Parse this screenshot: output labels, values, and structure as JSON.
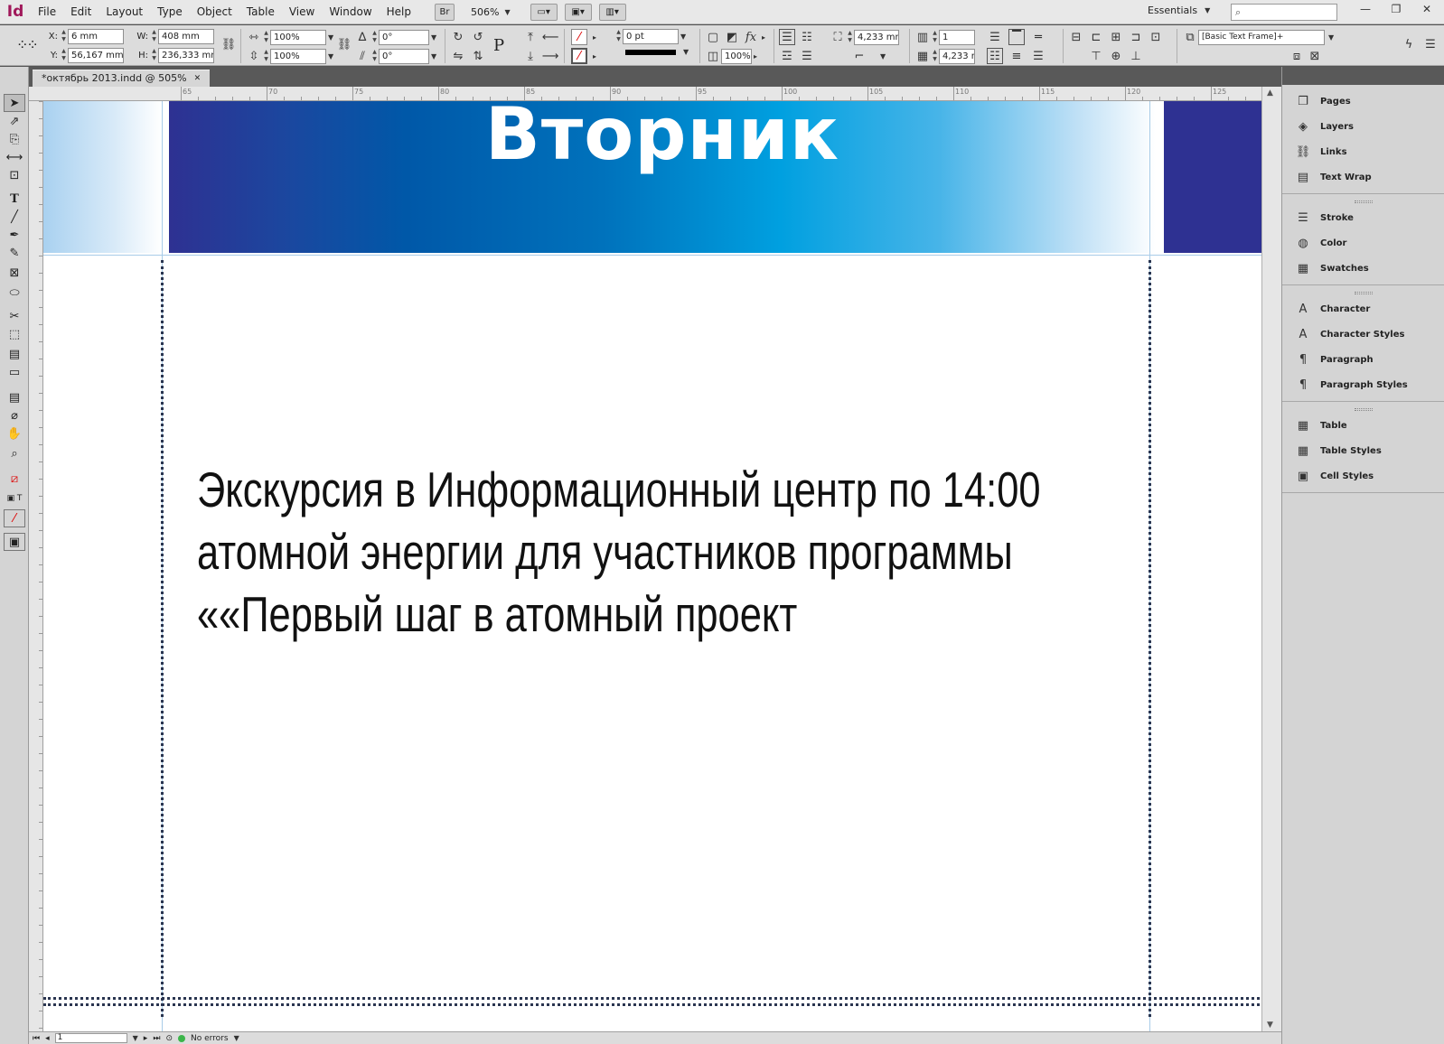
{
  "app": {
    "logo": "Id"
  },
  "menu": [
    "File",
    "Edit",
    "Layout",
    "Type",
    "Object",
    "Table",
    "View",
    "Window",
    "Help"
  ],
  "toolbar": {
    "bridge_label": "Br",
    "zoom": "506%"
  },
  "workspace": {
    "label": "Essentials"
  },
  "search": {
    "placeholder": ""
  },
  "control": {
    "x_label": "X:",
    "x": "6 mm",
    "y_label": "Y:",
    "y": "56,167 mm",
    "w_label": "W:",
    "w": "408 mm",
    "h_label": "H:",
    "h": "236,333 mm",
    "scale_x": "100%",
    "scale_y": "100%",
    "rotate": "0°",
    "shear": "0°",
    "stroke_weight": "0 pt",
    "opacity": "100%",
    "gutter": "4,233 mm",
    "columns": "1",
    "gutter2": "4,233 m",
    "object_style": "[Basic Text Frame]+"
  },
  "document_tab": {
    "title": "*октябрь 2013.indd @ 505%"
  },
  "ruler_h": [
    "65",
    "70",
    "75",
    "80",
    "85",
    "90",
    "95",
    "100",
    "105",
    "110",
    "115",
    "120",
    "125"
  ],
  "page": {
    "day_title": "Вторник",
    "body_lines": [
      "Экскурсия в Информационный центр по 14:00",
      "атомной энергии для участников программы",
      "««Первый шаг в атомный проект"
    ]
  },
  "status": {
    "page": "1",
    "errors": "No errors"
  },
  "panels": [
    [
      {
        "label": "Pages",
        "icon": "pages-icon"
      },
      {
        "label": "Layers",
        "icon": "layers-icon"
      },
      {
        "label": "Links",
        "icon": "links-icon"
      },
      {
        "label": "Text Wrap",
        "icon": "text-wrap-icon"
      }
    ],
    [
      {
        "label": "Stroke",
        "icon": "stroke-icon"
      },
      {
        "label": "Color",
        "icon": "color-icon"
      },
      {
        "label": "Swatches",
        "icon": "swatches-icon"
      }
    ],
    [
      {
        "label": "Character",
        "icon": "character-icon"
      },
      {
        "label": "Character Styles",
        "icon": "character-styles-icon"
      },
      {
        "label": "Paragraph",
        "icon": "paragraph-icon"
      },
      {
        "label": "Paragraph Styles",
        "icon": "paragraph-styles-icon"
      }
    ],
    [
      {
        "label": "Table",
        "icon": "table-icon"
      },
      {
        "label": "Table Styles",
        "icon": "table-styles-icon"
      },
      {
        "label": "Cell Styles",
        "icon": "cell-styles-icon"
      }
    ]
  ],
  "colors": {
    "brand_dark": "#2e3192",
    "brand_mid": "#0072bc",
    "brand_light": "#00a0e0",
    "app_accent": "#a0185a"
  }
}
